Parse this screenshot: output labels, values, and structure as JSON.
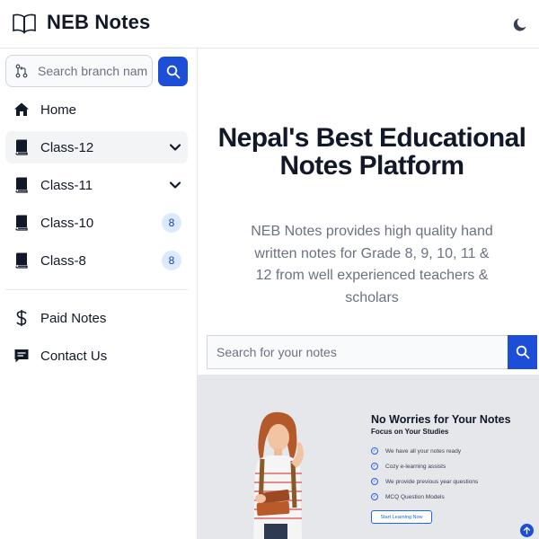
{
  "header": {
    "title": "NEB Notes",
    "logo_icon": "open-book-icon",
    "theme_icon": "moon-icon"
  },
  "sidebar": {
    "search": {
      "placeholder": "Search branch name",
      "value": ""
    },
    "items": [
      {
        "label": "Home",
        "icon": "home-icon"
      },
      {
        "label": "Class-12",
        "icon": "book-icon",
        "expandable": true,
        "active": true
      },
      {
        "label": "Class-11",
        "icon": "book-icon",
        "expandable": true
      },
      {
        "label": "Class-10",
        "icon": "book-icon",
        "badge": "8"
      },
      {
        "label": "Class-8",
        "icon": "book-icon",
        "badge": "8"
      },
      {
        "label": "Paid Notes",
        "icon": "dollar-icon"
      },
      {
        "label": "Contact Us",
        "icon": "message-icon"
      }
    ]
  },
  "hero": {
    "title": "Nepal's Best Educational Notes Platform",
    "subtitle": "NEB Notes provides high quality hand written notes for Grade 8, 9, 10, 11 & 12 from well experienced teachers & scholars",
    "search_placeholder": "Search for your notes"
  },
  "banner": {
    "title": "No Worries for Your Notes",
    "subtitle": "Focus on Your Studies",
    "features": [
      "We have all your notes ready",
      "Cozy e-learning assists",
      "We provide previous year questions",
      "MCQ Question Models"
    ],
    "cta": "Start Learning Now"
  },
  "colors": {
    "accent": "#1d4ed8",
    "badge_bg": "#dbeafe",
    "badge_text": "#1e40af",
    "banner_bg": "#e5e7eb"
  }
}
